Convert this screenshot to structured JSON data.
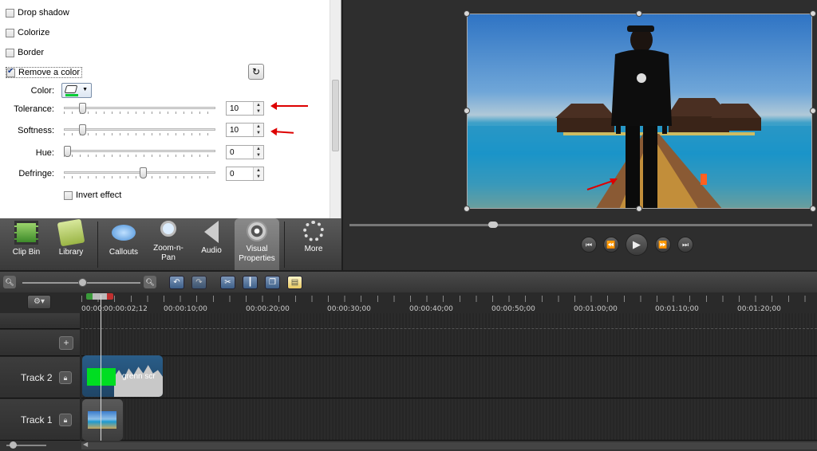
{
  "properties": {
    "checkboxes": [
      {
        "label": "Drop shadow",
        "checked": false
      },
      {
        "label": "Colorize",
        "checked": false
      },
      {
        "label": "Border",
        "checked": false
      },
      {
        "label": "Remove a color",
        "checked": true
      }
    ],
    "color_label": "Color:",
    "color_value": "#00cc33",
    "sliders": [
      {
        "label": "Tolerance:",
        "value": "10",
        "level": 0.1
      },
      {
        "label": "Softness:",
        "value": "10",
        "level": 0.1
      },
      {
        "label": "Hue:",
        "value": "0",
        "level": 0.0
      },
      {
        "label": "Defringe:",
        "value": "0",
        "level": 0.5
      }
    ],
    "invert_label": "Invert effect",
    "invert_checked": false
  },
  "tabs": [
    {
      "label": "Clip Bin",
      "icon": "film-strip-icon"
    },
    {
      "label": "Library",
      "icon": "library-icon"
    },
    {
      "label": "Callouts",
      "icon": "speech-bubble-icon"
    },
    {
      "label": "Zoom-n-\nPan",
      "icon": "magnifier-icon"
    },
    {
      "label": "Audio",
      "icon": "speaker-icon"
    },
    {
      "label": "Visual\nProperties",
      "icon": "visual-properties-icon",
      "active": true
    },
    {
      "label": "More",
      "icon": "more-dots-icon"
    }
  ],
  "preview": {
    "playback_progress": 0.3,
    "controls": [
      "skip-back-icon",
      "rewind-icon",
      "play-icon",
      "fast-forward-icon",
      "skip-forward-icon"
    ]
  },
  "timeline": {
    "ruler": [
      "00:00:00;00",
      "00:00:02;12",
      "00:00:10;00",
      "00:00:20;00",
      "00:00:30;00",
      "00:00:40;00",
      "00:00:50;00",
      "00:01:00;00",
      "00:01:10;00",
      "00:01:20;00"
    ],
    "tracks": [
      {
        "label": "Track 2",
        "clip_label": "grenn scr"
      },
      {
        "label": "Track 1",
        "clip_label": ""
      }
    ]
  },
  "colors": {
    "accent": "#3e5f88",
    "green_screen": "#00dd22",
    "arrow": "#d00000"
  }
}
